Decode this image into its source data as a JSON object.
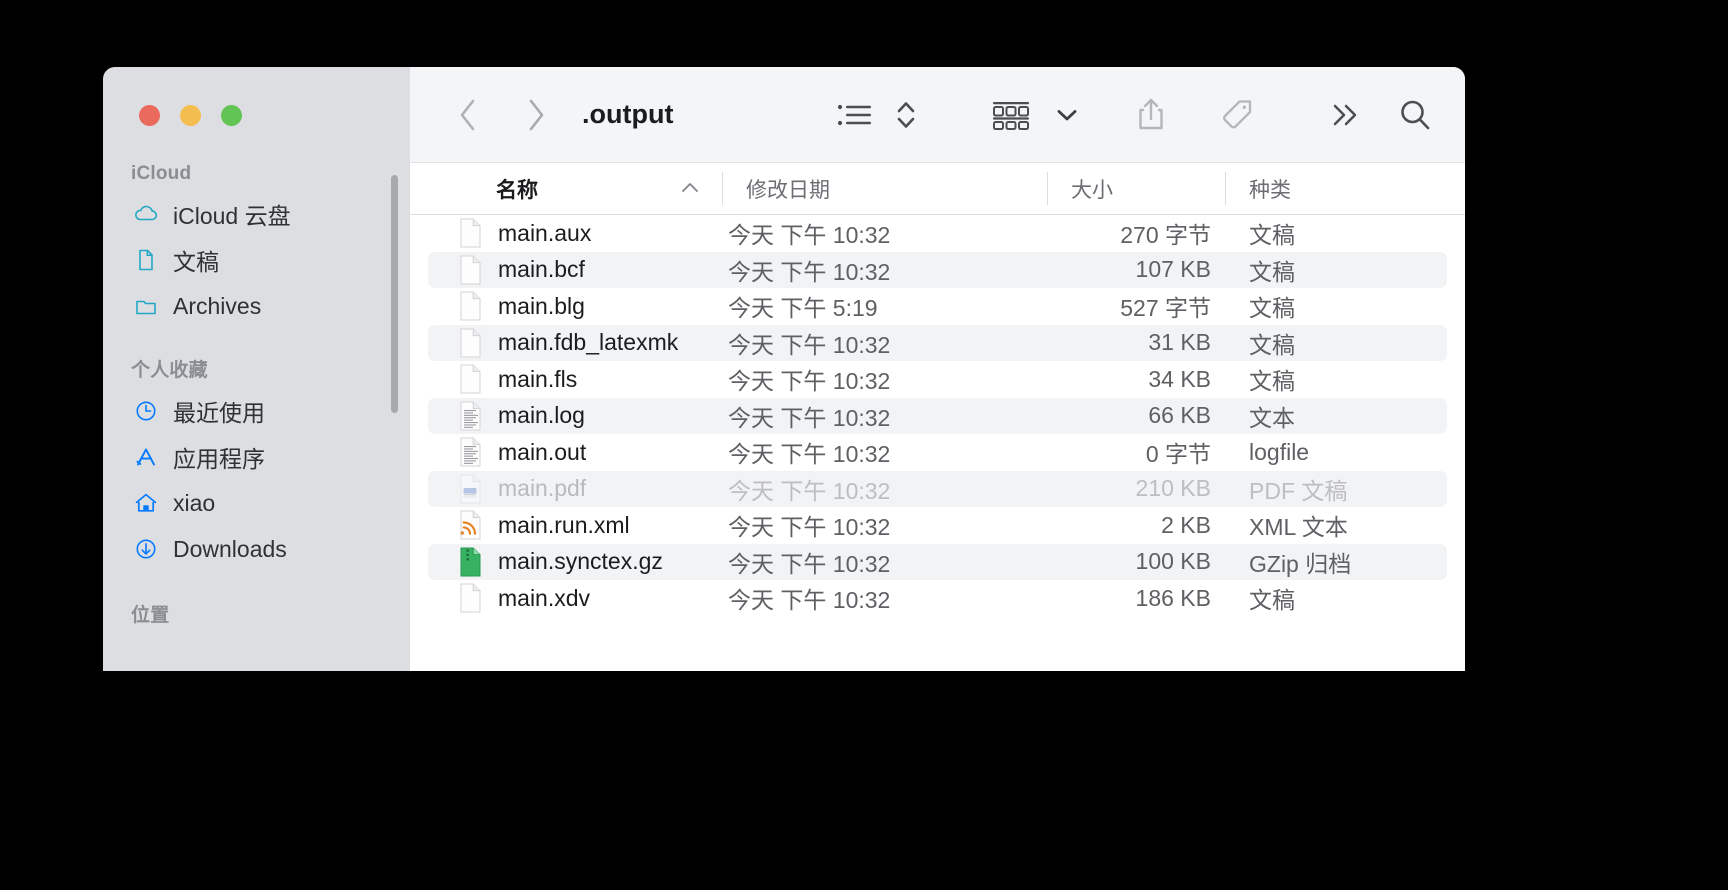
{
  "window": {
    "traffic_lights": [
      "close",
      "minimize",
      "zoom"
    ],
    "colors": {
      "close": "#eb6a5e",
      "minimize": "#f4bd4f",
      "zoom": "#61c454",
      "accent": "#007aff",
      "sidebar_bg": "#dddee1",
      "toolbar_bg": "#f4f5f7"
    }
  },
  "toolbar": {
    "back_icon": "chevron-left-icon",
    "forward_icon": "chevron-right-icon",
    "title": ".output",
    "view_list_icon": "list-view-icon",
    "sort_icon": "sort-updown-icon",
    "group_icon": "group-by-icon",
    "group_chevron_icon": "chevron-down-icon",
    "share_icon": "share-icon",
    "tag_icon": "tag-icon",
    "more_icon": "double-chevron-right-icon",
    "search_icon": "search-icon"
  },
  "sidebar": {
    "sections": [
      {
        "title": "iCloud",
        "items": [
          {
            "label": "iCloud 云盘",
            "icon": "cloud-icon"
          },
          {
            "label": "文稿",
            "icon": "document-icon"
          },
          {
            "label": "Archives",
            "icon": "folder-icon"
          }
        ]
      },
      {
        "title": "个人收藏",
        "items": [
          {
            "label": "最近使用",
            "icon": "clock-icon"
          },
          {
            "label": "应用程序",
            "icon": "applications-icon"
          },
          {
            "label": "xiao",
            "icon": "home-icon"
          },
          {
            "label": "Downloads",
            "icon": "downloads-arrow-icon"
          }
        ]
      },
      {
        "title": "位置",
        "items": []
      }
    ]
  },
  "columns": {
    "name": "名称",
    "date_modified": "修改日期",
    "size": "大小",
    "kind": "种类",
    "sort_indicator": "ascending"
  },
  "files": [
    {
      "name": "main.aux",
      "date": "今天 下午 10:32",
      "size": "270 字节",
      "kind": "文稿",
      "icon": "blank-doc-icon",
      "dimmed": false
    },
    {
      "name": "main.bcf",
      "date": "今天 下午 10:32",
      "size": "107 KB",
      "kind": "文稿",
      "icon": "blank-doc-icon",
      "dimmed": false
    },
    {
      "name": "main.blg",
      "date": "今天 下午 5:19",
      "size": "527 字节",
      "kind": "文稿",
      "icon": "blank-doc-icon",
      "dimmed": false
    },
    {
      "name": "main.fdb_latexmk",
      "date": "今天 下午 10:32",
      "size": "31 KB",
      "kind": "文稿",
      "icon": "blank-doc-icon",
      "dimmed": false
    },
    {
      "name": "main.fls",
      "date": "今天 下午 10:32",
      "size": "34 KB",
      "kind": "文稿",
      "icon": "blank-doc-icon",
      "dimmed": false
    },
    {
      "name": "main.log",
      "date": "今天 下午 10:32",
      "size": "66 KB",
      "kind": "文本",
      "icon": "text-doc-icon",
      "dimmed": false
    },
    {
      "name": "main.out",
      "date": "今天 下午 10:32",
      "size": "0 字节",
      "kind": "logfile",
      "icon": "text-doc-icon",
      "dimmed": false
    },
    {
      "name": "main.pdf",
      "date": "今天 下午 10:32",
      "size": "210 KB",
      "kind": "PDF 文稿",
      "icon": "pdf-doc-icon",
      "dimmed": true
    },
    {
      "name": "main.run.xml",
      "date": "今天 下午 10:32",
      "size": "2 KB",
      "kind": "XML 文本",
      "icon": "xml-rss-doc-icon",
      "dimmed": false
    },
    {
      "name": "main.synctex.gz",
      "date": "今天 下午 10:32",
      "size": "100 KB",
      "kind": "GZip 归档",
      "icon": "archive-doc-icon",
      "dimmed": false
    },
    {
      "name": "main.xdv",
      "date": "今天 下午 10:32",
      "size": "186 KB",
      "kind": "文稿",
      "icon": "blank-doc-icon",
      "dimmed": false
    }
  ]
}
